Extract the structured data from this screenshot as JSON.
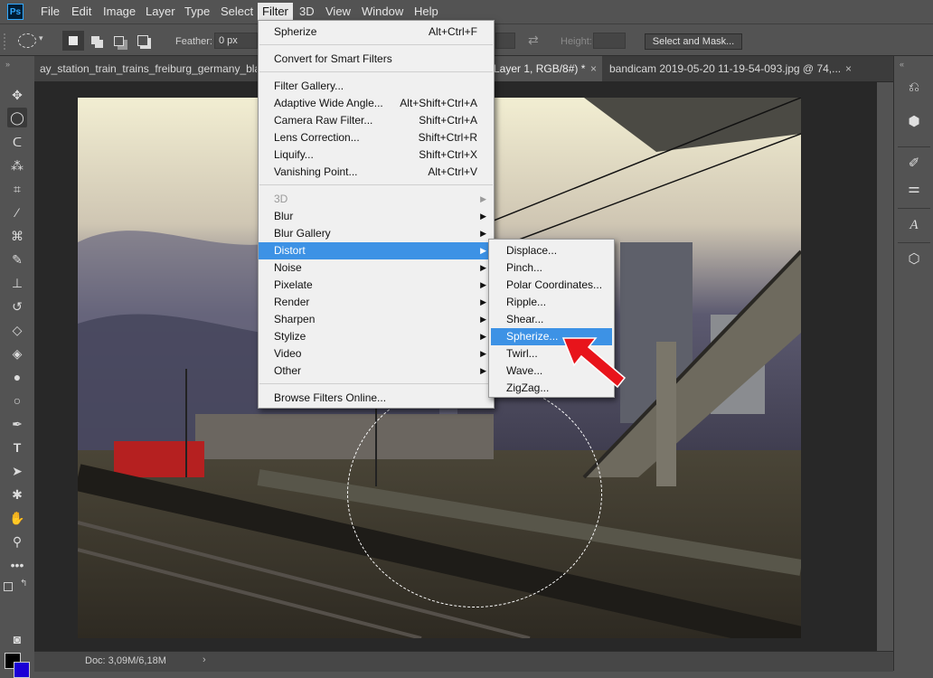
{
  "app": {
    "logo": "Ps"
  },
  "menubar": {
    "items": [
      "File",
      "Edit",
      "Image",
      "Layer",
      "Type",
      "Select",
      "Filter",
      "3D",
      "View",
      "Window",
      "Help"
    ],
    "active": "Filter"
  },
  "options": {
    "feather_label": "Feather:",
    "feather_value": "0 px",
    "height_label": "Height:",
    "select_mask": "Select and Mask..."
  },
  "tabs": [
    {
      "title": "ay_station_train_trains_freiburg_germany_black"
    },
    {
      "title": "Layer 1, RGB/8#) *",
      "close": "×"
    },
    {
      "title": "bandicam 2019-05-20 11-19-54-093.jpg @ 74,...",
      "close": "×"
    }
  ],
  "status": {
    "doc": "Doc: 3,09M/6,18M",
    "arrow": "›"
  },
  "filter_menu": {
    "items": [
      {
        "label": "Spherize",
        "shortcut": "Alt+Ctrl+F"
      },
      {
        "label": "Convert for Smart Filters"
      },
      {
        "label": "Filter Gallery..."
      },
      {
        "label": "Adaptive Wide Angle...",
        "shortcut": "Alt+Shift+Ctrl+A"
      },
      {
        "label": "Camera Raw Filter...",
        "shortcut": "Shift+Ctrl+A"
      },
      {
        "label": "Lens Correction...",
        "shortcut": "Shift+Ctrl+R"
      },
      {
        "label": "Liquify...",
        "shortcut": "Shift+Ctrl+X"
      },
      {
        "label": "Vanishing Point...",
        "shortcut": "Alt+Ctrl+V"
      },
      {
        "label": "3D"
      },
      {
        "label": "Blur"
      },
      {
        "label": "Blur Gallery"
      },
      {
        "label": "Distort"
      },
      {
        "label": "Noise"
      },
      {
        "label": "Pixelate"
      },
      {
        "label": "Render"
      },
      {
        "label": "Sharpen"
      },
      {
        "label": "Stylize"
      },
      {
        "label": "Video"
      },
      {
        "label": "Other"
      },
      {
        "label": "Browse Filters Online..."
      }
    ]
  },
  "distort_menu": {
    "items": [
      "Displace...",
      "Pinch...",
      "Polar Coordinates...",
      "Ripple...",
      "Shear...",
      "Spherize...",
      "Twirl...",
      "Wave...",
      "ZigZag..."
    ],
    "highlighted": "Spherize..."
  },
  "colors": {
    "menu_highlight": "#3d92e5",
    "arrow": "#e8141b",
    "foreground": "#000000",
    "background": "#1a00d6"
  }
}
